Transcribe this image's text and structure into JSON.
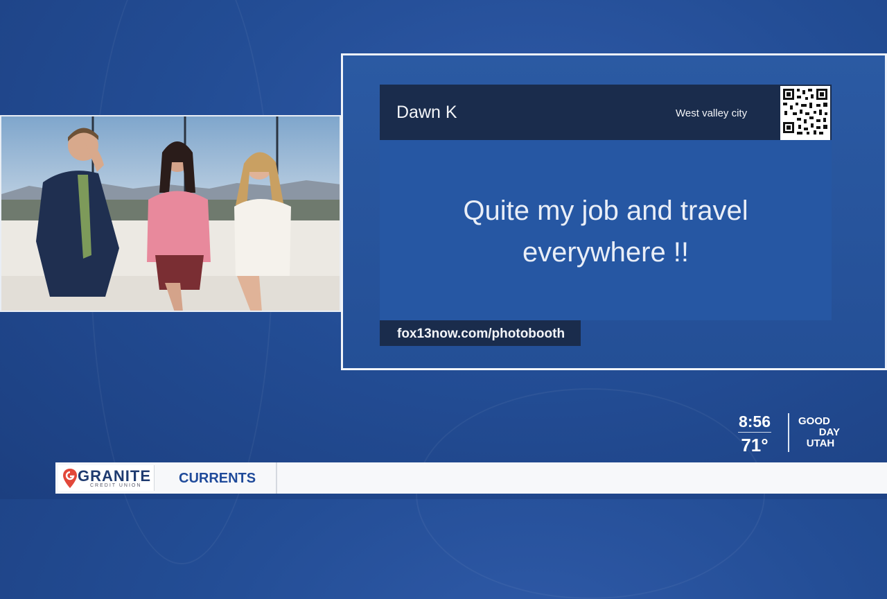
{
  "card": {
    "sender_name": "Dawn K",
    "sender_location": "West valley city",
    "message_line1": "Quite my job and travel",
    "message_line2": "everywhere !!",
    "url": "fox13now.com/photobooth",
    "qr_caption": "fox13now.com/photobooth"
  },
  "bug": {
    "time": "8:56",
    "temperature": "71°",
    "show_line1": "GOOD",
    "show_line2": "DAY",
    "show_line3": "UTAH"
  },
  "ticker": {
    "sponsor_name": "GRANITE",
    "sponsor_sub": "CREDIT UNION",
    "segment_label": "CURRENTS"
  },
  "colors": {
    "background": "#234d95",
    "card_header": "#1a2c4c",
    "card_body": "#2657a3",
    "sponsor_accent": "#e2483a"
  }
}
